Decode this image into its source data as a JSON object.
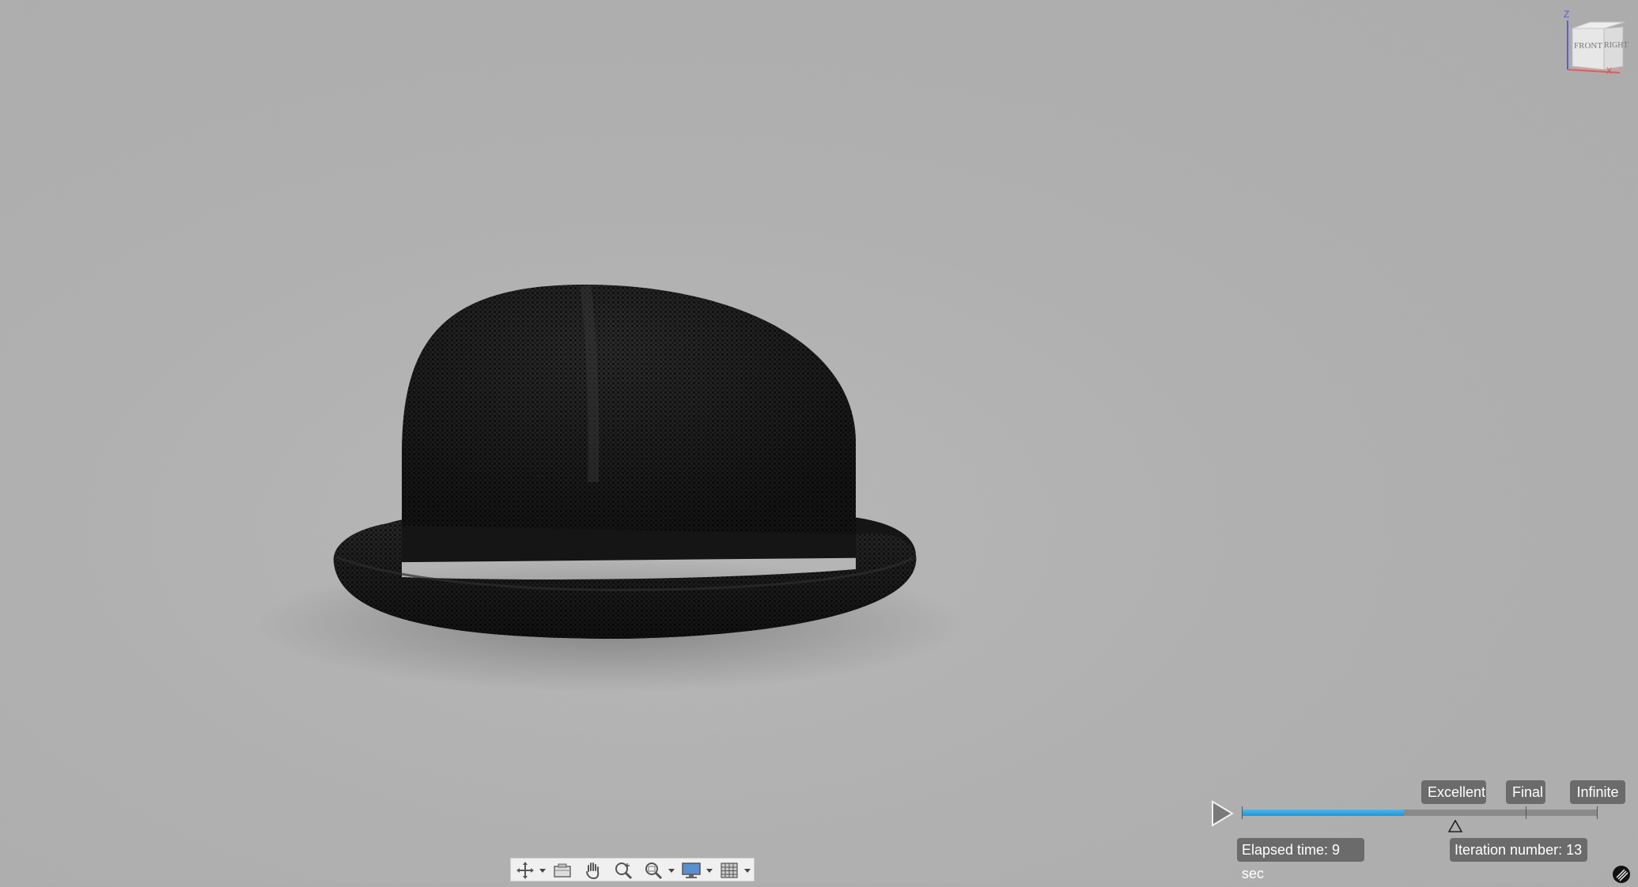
{
  "viewcube": {
    "front_label": "FRONT",
    "right_label": "RIGHT",
    "axis_z": "Z",
    "axis_x": "X"
  },
  "render_progress": {
    "quality_levels": {
      "excellent": "Excellent",
      "final": "Final",
      "infinite": "Infinite"
    },
    "progress_fraction": 0.455,
    "elapsed_time": "Elapsed time: 9 sec",
    "iteration_number": "Iteration number: 13",
    "fill_color": "#1d95d6"
  },
  "toolbar": {
    "items": [
      "orbit-icon",
      "look-at-icon",
      "pan-icon",
      "zoom-icon",
      "fit-icon",
      "display-settings-icon",
      "grid-and-snaps-icon"
    ]
  },
  "scene": {
    "object": "bowler hat",
    "background_color": "#b0b0b0",
    "object_color": "#1a1a1a"
  }
}
